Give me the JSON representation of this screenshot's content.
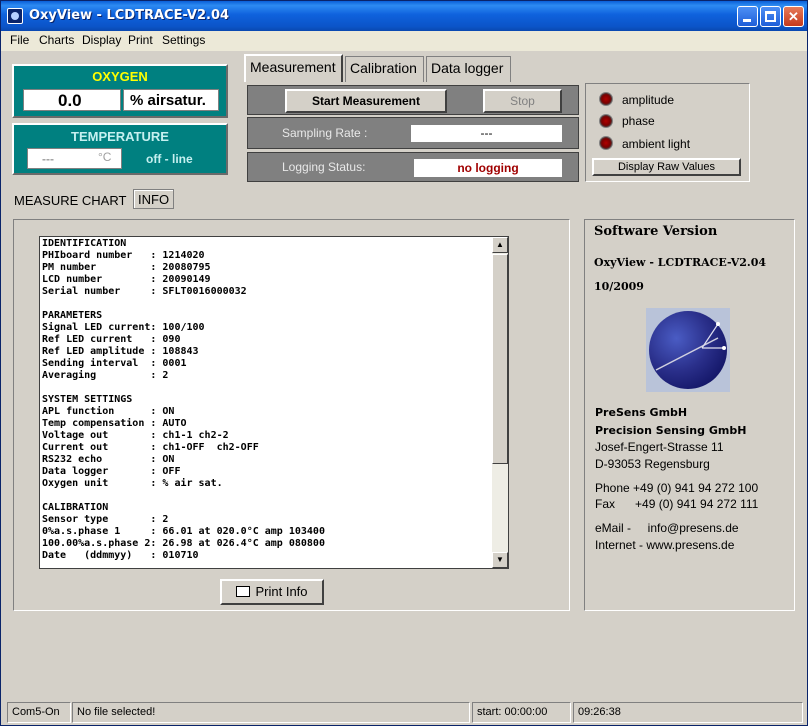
{
  "window": {
    "title": "OxyView - LCDTRACE-V2.04"
  },
  "menu": {
    "file": "File",
    "charts": "Charts",
    "display": "Display",
    "print": "Print",
    "settings": "Settings"
  },
  "oxygen": {
    "label": "OXYGEN",
    "value": "0.0",
    "unit": "% airsatur."
  },
  "temperature": {
    "label": "TEMPERATURE",
    "value": "---",
    "unit": "°C",
    "mode": "off - line"
  },
  "tabs": {
    "measurement": "Measurement",
    "calibration": "Calibration",
    "data_logger": "Data logger"
  },
  "controls": {
    "start_button": "Start Measurement",
    "stop_button": "Stop",
    "sampling_rate_label": "Sampling Rate :",
    "sampling_rate_value": "---",
    "logging_status_label": "Logging Status:",
    "logging_status_value": "no logging"
  },
  "indicators": {
    "amplitude": "amplitude",
    "phase": "phase",
    "ambient_light": "ambient light",
    "raw_values_button": "Display Raw Values"
  },
  "inner_tabs": {
    "measure_chart": "MEASURE CHART",
    "info": "INFO"
  },
  "info_text": "IDENTIFICATION\nPHIboard number   : 1214020\nPM number         : 20080795\nLCD number        : 20090149\nSerial number     : SFLT0016000032\n\nPARAMETERS\nSignal LED current: 100/100\nRef LED current   : 090\nRef LED amplitude : 108843\nSending interval  : 0001\nAveraging         : 2\n\nSYSTEM SETTINGS\nAPL function      : ON\nTemp compensation : AUTO\nVoltage out       : ch1-1 ch2-2\nCurrent out       : ch1-OFF  ch2-OFF\nRS232 echo        : ON\nData logger       : OFF\nOxygen unit       : % air sat.\n\nCALIBRATION\nSensor type       : 2\n0%a.s.phase 1     : 66.01 at 020.0°C amp 103400\n100.00%a.s.phase 2: 26.98 at 026.4°C amp 080800\nDate   (ddmmyy)   : 010710",
  "print_info_button": "Print Info",
  "software": {
    "heading": "Software Version",
    "version": "OxyView - LCDTRACE-V2.04",
    "date": "10/2009",
    "company": "PreSens GmbH",
    "company_full": "Precision Sensing GmbH",
    "street": "Josef-Engert-Strasse 11",
    "city": "D-93053 Regensburg",
    "phone": "Phone +49 (0) 941 94 272 100",
    "fax": "Fax      +49 (0) 941 94 272 111",
    "email": "eMail -     info@presens.de",
    "internet": "Internet - www.presens.de"
  },
  "status": {
    "port": "Com5-On",
    "file": "No file selected!",
    "start": "start: 00:00:00",
    "time": "09:26:38"
  },
  "colors": {
    "teal": "#008080",
    "oxygen_header": "#ffff00",
    "logging_red": "#800000"
  }
}
